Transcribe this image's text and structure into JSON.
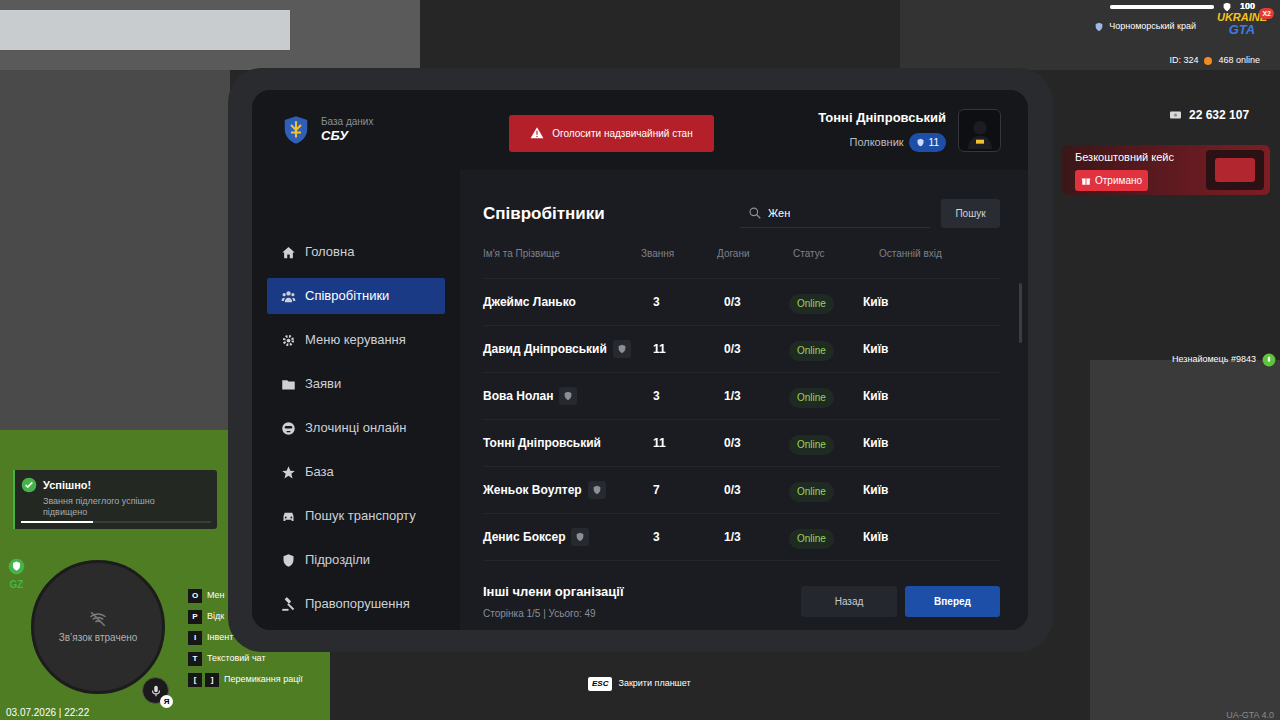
{
  "hud": {
    "region": "Чорноморський край",
    "logo": {
      "line1": "UKRAINE",
      "line2": "GTA",
      "badge": "X2"
    },
    "player_id": "ID: 324",
    "online": "468 online",
    "health": {
      "value": "100",
      "level": 1
    },
    "armor": {
      "value": "100",
      "level": 1
    },
    "money": "22 632 107"
  },
  "promo": {
    "title": "Безкоштовний кейс",
    "button": "Отримано"
  },
  "player_tag": "Незнайомець #9843",
  "notification": {
    "title": "Успішно!",
    "text": "Звання підлеглого успішно підвищено",
    "level": 0.38
  },
  "zone": "GZ",
  "minimap": {
    "status": "Зв’язок втрачено"
  },
  "hints": [
    {
      "keys": [
        "O"
      ],
      "label": "Мен"
    },
    {
      "keys": [
        "P"
      ],
      "label": "Відк"
    },
    {
      "keys": [
        "I"
      ],
      "label": "Інвент"
    },
    {
      "keys": [
        "T"
      ],
      "label": "Текстовий чат"
    },
    {
      "keys": [
        "[",
        "]"
      ],
      "label": "Перемикання рації"
    }
  ],
  "mic": {
    "badge": "Я"
  },
  "clock": "03.07.2026 | 22:22",
  "close_hint": {
    "key": "ESC",
    "label": "Закрити планшет"
  },
  "version": "UA-GTA 4.0",
  "tablet": {
    "brand": {
      "subtitle": "База даних",
      "title": "СБУ"
    },
    "emergency_button": "Оголосити надзвичайний стан",
    "user": {
      "name": "Тонні Дніпровський",
      "rank": "Полковник",
      "level": "11"
    },
    "sidebar": {
      "items": [
        {
          "label": "Головна",
          "selected": false
        },
        {
          "label": "Співробітники",
          "selected": true
        },
        {
          "label": "Меню керування",
          "selected": false
        },
        {
          "label": "Заяви",
          "selected": false
        },
        {
          "label": "Злочинці онлайн",
          "selected": false
        },
        {
          "label": "База",
          "selected": false
        },
        {
          "label": "Пошук транспорту",
          "selected": false
        },
        {
          "label": "Підрозділи",
          "selected": false
        },
        {
          "label": "Правопорушення",
          "selected": false
        }
      ]
    },
    "page": {
      "title": "Співробітники",
      "search": {
        "value": "Жен"
      },
      "search_button": "Пошук",
      "table": {
        "columns": [
          "Ім'я та Прізвище",
          "Звання",
          "Догани",
          "Статус",
          "Останній вхід"
        ],
        "rows": [
          {
            "name": "Джеймс Ланько",
            "shield": false,
            "rank": "3",
            "reprimands": "0/3",
            "status": "Online",
            "last_login": "Київ"
          },
          {
            "name": "Давид Дніпровський",
            "shield": true,
            "rank": "11",
            "reprimands": "0/3",
            "status": "Online",
            "last_login": "Київ"
          },
          {
            "name": "Вова Нолан",
            "shield": true,
            "rank": "3",
            "reprimands": "1/3",
            "status": "Online",
            "last_login": "Київ"
          },
          {
            "name": "Тонні Дніпровський",
            "shield": false,
            "rank": "11",
            "reprimands": "0/3",
            "status": "Online",
            "last_login": "Київ"
          },
          {
            "name": "Женьок Воултер",
            "shield": true,
            "rank": "7",
            "reprimands": "0/3",
            "status": "Online",
            "last_login": "Київ"
          },
          {
            "name": "Денис Боксер",
            "shield": true,
            "rank": "3",
            "reprimands": "1/3",
            "status": "Online",
            "last_login": "Київ"
          }
        ]
      },
      "footer": {
        "title": "Інші члени організації",
        "pagination": "Сторінка 1/5 | Усього: 49",
        "prev": "Назад",
        "next": "Вперед"
      }
    }
  }
}
